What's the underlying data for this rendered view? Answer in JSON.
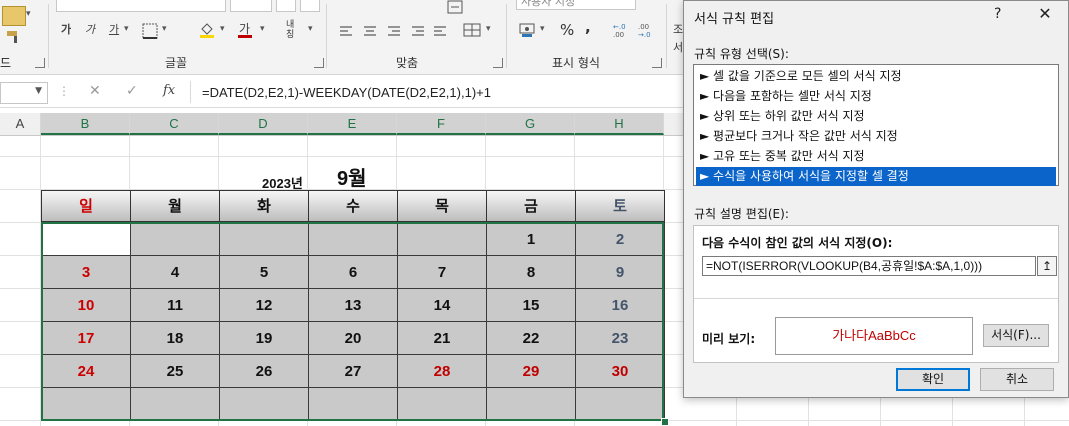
{
  "ribbon": {
    "groups": {
      "font": "글꼴",
      "align": "맞춤",
      "number": "표시 형식"
    },
    "number_format": "사용자 지정",
    "font_btns": [
      "가",
      "가",
      "가"
    ],
    "percent": "%",
    "comma": ",",
    "fit": "내칭",
    "left_edge_label": "드",
    "right_edge_label_1": "조",
    "right_edge_label_2": "서"
  },
  "formula_bar": {
    "cancel_icon": "✕",
    "enter_icon": "✓",
    "fx_icon": "fx",
    "formula": "=DATE(D2,E2,1)-WEEKDAY(DATE(D2,E2,1),1)+1"
  },
  "columns": [
    "A",
    "B",
    "C",
    "D",
    "E",
    "F",
    "G",
    "H"
  ],
  "calendar": {
    "year": "2023년",
    "month": "9월",
    "weekdays": [
      "일",
      "월",
      "화",
      "수",
      "목",
      "금",
      "토"
    ],
    "weeks": [
      [
        "",
        "",
        "",
        "",
        "",
        "1",
        "2"
      ],
      [
        "3",
        "4",
        "5",
        "6",
        "7",
        "8",
        "9"
      ],
      [
        "10",
        "11",
        "12",
        "13",
        "14",
        "15",
        "16"
      ],
      [
        "17",
        "18",
        "19",
        "20",
        "21",
        "22",
        "23"
      ],
      [
        "24",
        "25",
        "26",
        "27",
        "28",
        "29",
        "30"
      ],
      [
        "",
        "",
        "",
        "",
        "",
        "",
        ""
      ]
    ],
    "colors": {
      "sunday": "#cc0000",
      "holiday": "#c00000",
      "saturday": "#44546a",
      "weekday": "#111111",
      "header_sat": "#44546a"
    }
  },
  "dialog": {
    "title": "서식 규칙 편집",
    "help": "?",
    "close": "✕",
    "rule_type_label": "규칙 유형 선택(S):",
    "rule_types": [
      "► 셀 값을 기준으로 모든 셀의 서식 지정",
      "► 다음을 포함하는 셀만 서식 지정",
      "► 상위 또는 하위 값만 서식 지정",
      "► 평균보다 크거나 작은 값만 서식 지정",
      "► 고유 또는 중복 값만 서식 지정",
      "► 수식을 사용하여 서식을 지정할 셀 결정"
    ],
    "selected_rule_index": 5,
    "edit_label": "규칙 설명 편집(E):",
    "formula_title": "다음 수식이 참인 값의 서식 지정(O):",
    "formula_value": "=NOT(ISERROR(VLOOKUP(B4,공휴일!$A:$A,1,0)))",
    "collapse_icon": "↥",
    "preview_label": "미리 보기:",
    "preview_text": "가나다AaBbCc",
    "format_button": "서식(F)...",
    "ok": "확인",
    "cancel": "취소"
  }
}
